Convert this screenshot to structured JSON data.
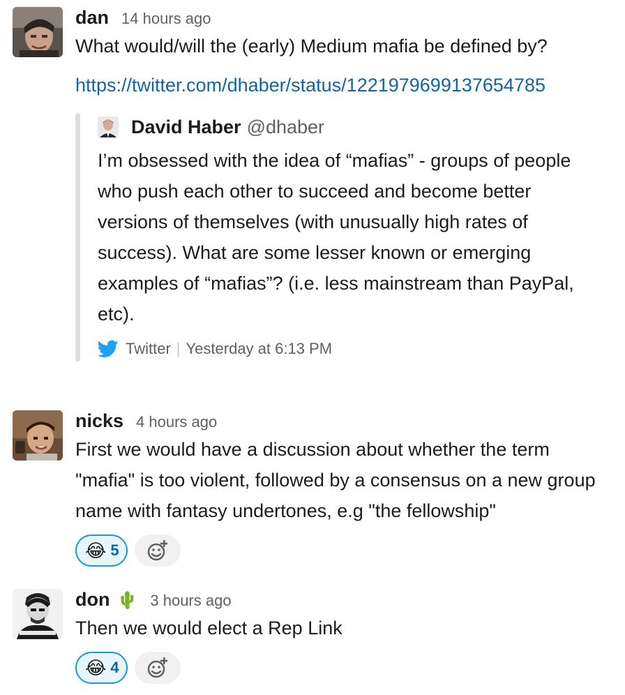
{
  "messages": [
    {
      "username": "dan",
      "timestamp": "14 hours ago",
      "text": "What would/will the (early) Medium mafia be defined by?",
      "link": "https://twitter.com/dhaber/status/1221979699137654785",
      "attachment": {
        "author_name": "David Haber",
        "author_handle": "@dhaber",
        "text": "I’m obsessed with the idea of “mafias” - groups of people who push each other to succeed and become better versions of themselves (with unusually high rates of success).  What are some lesser known or emerging examples of “mafias”? (i.e. less mainstream than PayPal, etc).",
        "footer_source": "Twitter",
        "footer_separator": "|",
        "footer_time": "Yesterday at 6:13 PM",
        "source_icon": "twitter-bird-icon"
      }
    },
    {
      "username": "nicks",
      "timestamp": "4 hours ago",
      "text": "First we would have a discussion about whether the term \"mafia\" is too violent, followed by a consensus on a new group name with fantasy undertones, e.g \"the fellowship\"",
      "reactions": [
        {
          "emoji": "😂",
          "count": "5"
        }
      ]
    },
    {
      "username": "don",
      "status_emoji": "🌵",
      "timestamp": "3 hours ago",
      "text": "Then we would elect a Rep Link",
      "reactions": [
        {
          "emoji": "😂",
          "count": "4"
        }
      ]
    }
  ],
  "icons": {
    "add_reaction": "add-reaction-icon"
  },
  "colors": {
    "link": "#1264a3",
    "reaction_border": "#1d9bd1",
    "reaction_bg": "#e8f5fa",
    "twitter_blue": "#1da1f2"
  }
}
